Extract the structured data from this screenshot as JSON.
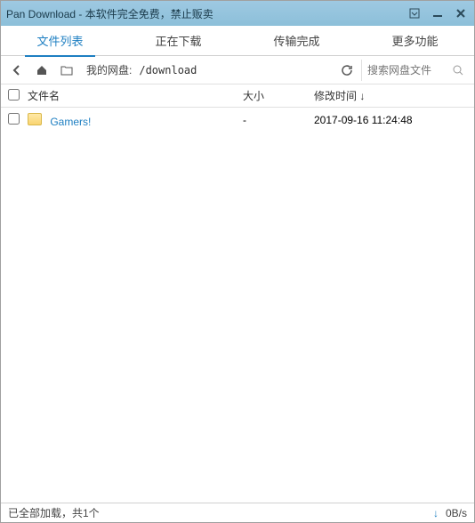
{
  "titlebar": {
    "title": "Pan Download - 本软件完全免费，禁止贩卖"
  },
  "tabs": {
    "file_list": "文件列表",
    "downloading": "正在下载",
    "completed": "传输完成",
    "more": "更多功能"
  },
  "toolbar": {
    "path_label": "我的网盘:",
    "path_value": "/download",
    "search_placeholder": "搜索网盘文件"
  },
  "columns": {
    "name": "文件名",
    "size": "大小",
    "mtime": "修改时间 ↓"
  },
  "files": [
    {
      "name": "Gamers!",
      "size": "-",
      "mtime": "2017-09-16 11:24:48"
    }
  ],
  "statusbar": {
    "left": "已全部加载，共1个",
    "speed": "0B/s"
  }
}
